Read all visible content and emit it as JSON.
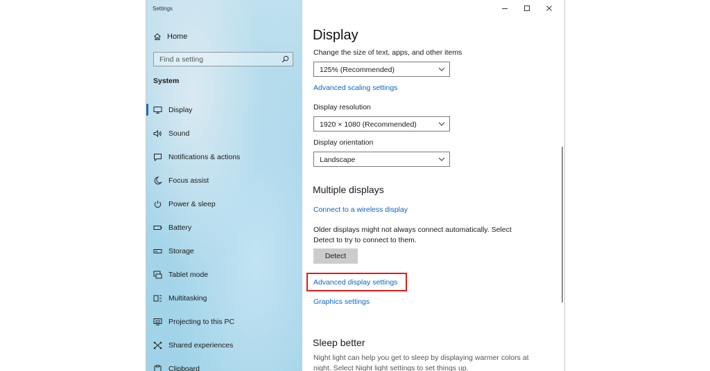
{
  "window": {
    "title": "Settings"
  },
  "sidebar": {
    "home_label": "Home",
    "search_placeholder": "Find a setting",
    "section": "System",
    "items": [
      {
        "label": "Display",
        "icon": "monitor-icon"
      },
      {
        "label": "Sound",
        "icon": "speaker-icon"
      },
      {
        "label": "Notifications & actions",
        "icon": "message-icon"
      },
      {
        "label": "Focus assist",
        "icon": "moon-icon"
      },
      {
        "label": "Power & sleep",
        "icon": "power-icon"
      },
      {
        "label": "Battery",
        "icon": "battery-icon"
      },
      {
        "label": "Storage",
        "icon": "storage-icon"
      },
      {
        "label": "Tablet mode",
        "icon": "tablet-icon"
      },
      {
        "label": "Multitasking",
        "icon": "multitasking-icon"
      },
      {
        "label": "Projecting to this PC",
        "icon": "projector-icon"
      },
      {
        "label": "Shared experiences",
        "icon": "share-icon"
      },
      {
        "label": "Clipboard",
        "icon": "clipboard-icon"
      }
    ],
    "active_index": 0
  },
  "main": {
    "title": "Display",
    "scale_label": "Change the size of text, apps, and other items",
    "scale_value": "125% (Recommended)",
    "advanced_scaling_link": "Advanced scaling settings",
    "resolution_label": "Display resolution",
    "resolution_value": "1920 × 1080 (Recommended)",
    "orientation_label": "Display orientation",
    "orientation_value": "Landscape",
    "multiple_displays_heading": "Multiple displays",
    "wireless_link": "Connect to a wireless display",
    "older_displays_text_1": "Older displays might not always connect automatically. Select",
    "older_displays_text_2": "Detect to try to connect to them.",
    "detect_button": "Detect",
    "advanced_display_link": "Advanced display settings",
    "graphics_link": "Graphics settings",
    "sleep_heading": "Sleep better",
    "night_light_text_1": "Night light can help you get to sleep by displaying warmer colors at",
    "night_light_text_2": "night. Select Night light settings to set things up."
  },
  "colors": {
    "accent": "#0b65c2",
    "highlight_box": "#e3181b",
    "active_indicator": "#1f6fb3"
  }
}
